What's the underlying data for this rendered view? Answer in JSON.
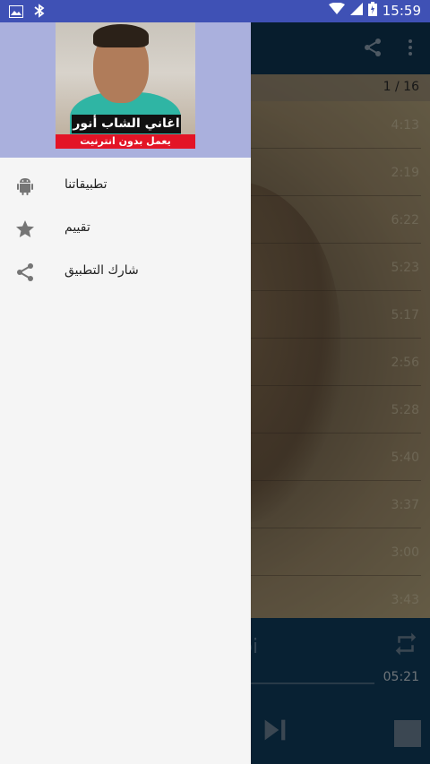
{
  "status_bar": {
    "time": "15:59",
    "icons": [
      "image-icon",
      "bluetooth-icon",
      "wifi-icon",
      "signal-icon",
      "battery-icon"
    ]
  },
  "drawer": {
    "header": {
      "caption_title": "اغاني الشاب أنور",
      "caption_subtitle": "يعمل بدون انترنيت"
    },
    "items": [
      {
        "label": "تطبيقاتنا",
        "icon": "android-icon"
      },
      {
        "label": "تقييم",
        "icon": "star-icon"
      },
      {
        "label": "شارك التطبيق",
        "icon": "share-icon"
      }
    ]
  },
  "background_app": {
    "track_counter": "1 / 16",
    "durations": [
      "4:13",
      "2:19",
      "6:22",
      "5:23",
      "5:17",
      "2:56",
      "5:28",
      "5:40",
      "3:37",
      "3:00",
      "3:43"
    ],
    "now_playing_title": "bi",
    "elapsed": "05:21",
    "toolbar_icons": [
      "share-icon",
      "more-vert-icon"
    ],
    "player_icons": [
      "repeat-icon",
      "skip-next-icon",
      "stop-icon"
    ]
  },
  "colors": {
    "status_bar": "#3F51B5",
    "drawer_header": "#aab0dd",
    "toolbar": "#0d3552",
    "player": "#103d5e"
  }
}
